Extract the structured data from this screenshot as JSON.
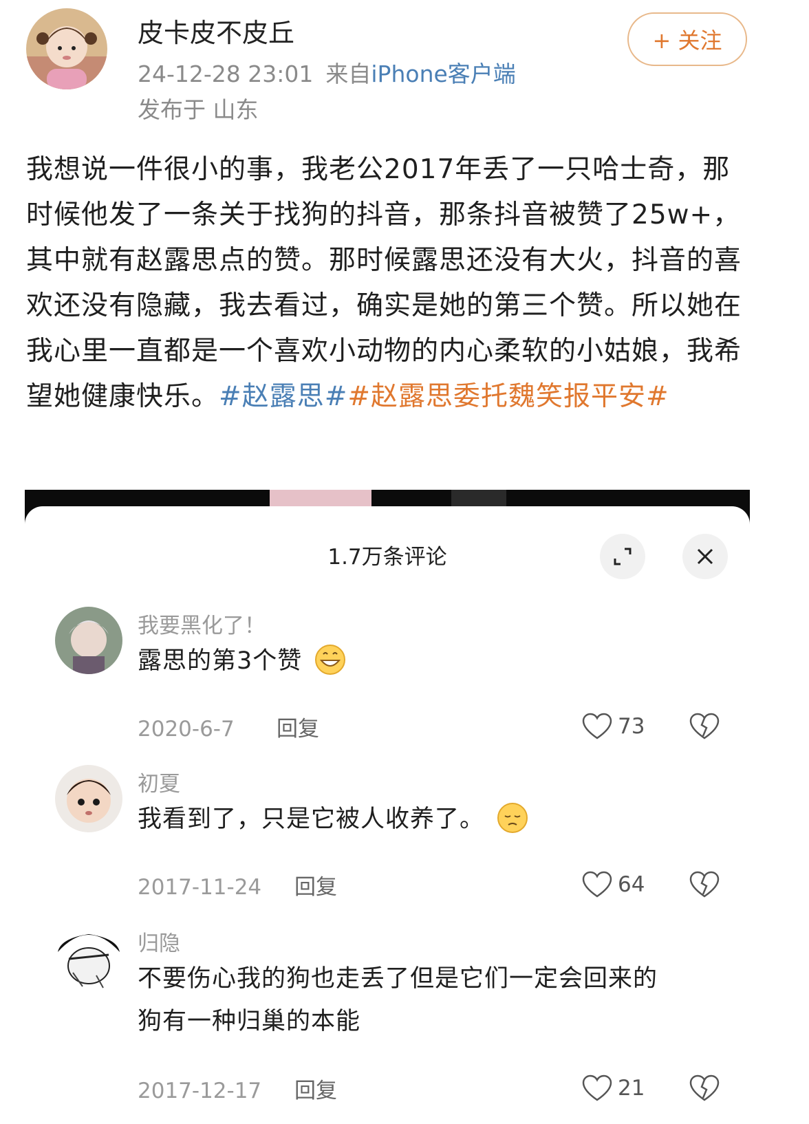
{
  "post": {
    "author": "皮卡皮不皮丘",
    "timestamp": "24-12-28 23:01",
    "source_prefix": "来自",
    "source_device": "iPhone客户端",
    "location": "发布于 山东",
    "follow_label": "+ 关注",
    "body": "我想说一件很小的事，我老公2017年丢了一只哈士奇，那时候他发了一条关于找狗的抖音，那条抖音被赞了25w+，其中就有赵露思点的赞。那时候露思还没有大火，抖音的喜欢还没有隐藏，我去看过，确实是她的第三个赞。所以她在我心里一直都是一个喜欢小动物的内心柔软的小姑娘，我希望她健康快乐。",
    "hashtag1": "#赵露思#",
    "hashtag2": "#赵露思委托魏笑报平安#"
  },
  "embed": {
    "comment_count_title": "1.7万条评论",
    "expand_icon": "expand-icon",
    "close_icon": "close-icon",
    "comments": [
      {
        "user": "我要黑化了！",
        "text": "露思的第3个赞",
        "emoji": "grin-emoji",
        "date": "2020-6-7",
        "reply_label": "回复",
        "likes": "73"
      },
      {
        "user": "初夏",
        "text": "我看到了，只是它被人收养了。",
        "emoji": "pensive-emoji",
        "date": "2017-11-24",
        "reply_label": "回复",
        "likes": "64"
      },
      {
        "user": "归隐",
        "text_line1": "不要伤心我的狗也走丢了但是它们一定会回来的",
        "text_line2": "狗有一种归巢的本能",
        "date": "2017-12-17",
        "reply_label": "回复",
        "likes": "21"
      }
    ]
  },
  "colors": {
    "link_blue": "#4a7fb5",
    "accent_orange": "#e0782f",
    "meta_gray": "#8a8a8a"
  }
}
